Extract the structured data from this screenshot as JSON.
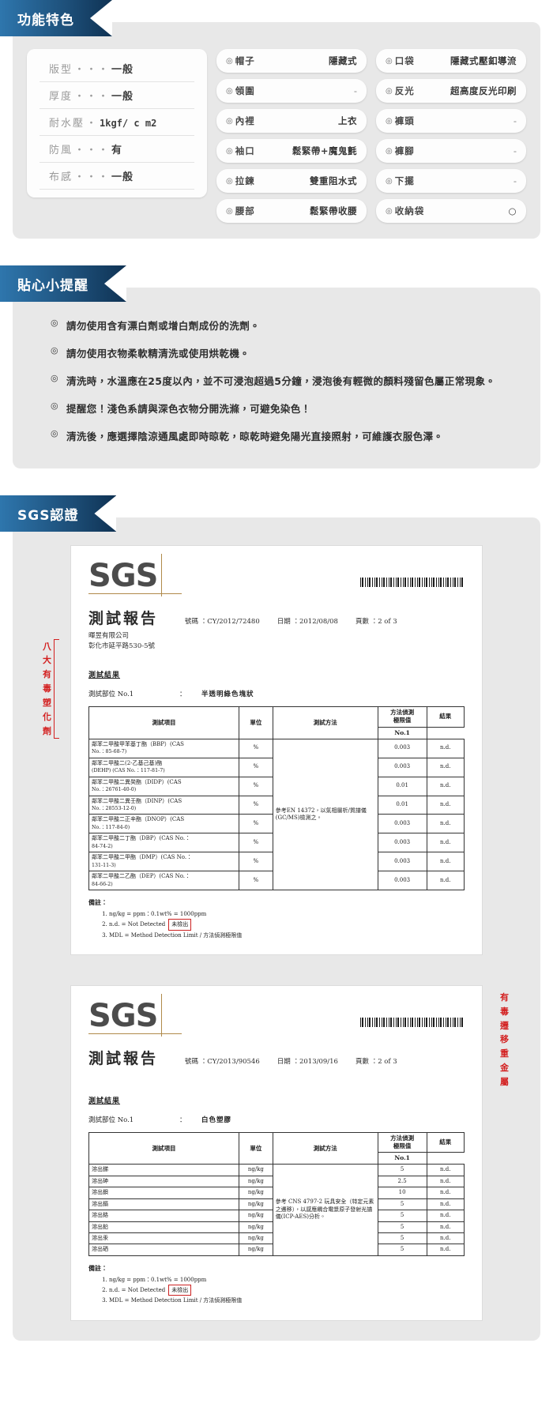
{
  "sections": {
    "features": {
      "title": "功能特色"
    },
    "tips": {
      "title": "貼心小提醒"
    },
    "sgs": {
      "title": "SGS認證"
    }
  },
  "spec_list": [
    {
      "label": "版型",
      "dots": "・・・",
      "value": "一般"
    },
    {
      "label": "厚度",
      "dots": "・・・",
      "value": "一般"
    },
    {
      "label": "耐水壓",
      "dots": "・",
      "value": "1kgf/ c m",
      "sup": "2"
    },
    {
      "label": "防風",
      "dots": "・・・",
      "value": "有"
    },
    {
      "label": "布感",
      "dots": "・・・",
      "value": "一般"
    }
  ],
  "feature_columns": [
    [
      {
        "ring": "◎",
        "name": "帽子",
        "value": "隱藏式"
      },
      {
        "ring": "◎",
        "name": "領圍",
        "value": "-"
      },
      {
        "ring": "◎",
        "name": "內裡",
        "value": "上衣"
      },
      {
        "ring": "◎",
        "name": "袖口",
        "value": "鬆緊帶+魔鬼氈"
      },
      {
        "ring": "◎",
        "name": "拉鍊",
        "value": "雙重阻水式"
      },
      {
        "ring": "◎",
        "name": "腰部",
        "value": "鬆緊帶收腰"
      }
    ],
    [
      {
        "ring": "◎",
        "name": "口袋",
        "value": "隱藏式壓釦導流"
      },
      {
        "ring": "◎",
        "name": "反光",
        "value": "超高度反光印刷"
      },
      {
        "ring": "◎",
        "name": "褲頭",
        "value": "-"
      },
      {
        "ring": "◎",
        "name": "褲腳",
        "value": "-"
      },
      {
        "ring": "◎",
        "name": "下擺",
        "value": "-"
      },
      {
        "ring": "◎",
        "name": "收納袋",
        "value": "○"
      }
    ]
  ],
  "tips": [
    {
      "bullet": "◎",
      "text": "請勿使用含有漂白劑或增白劑成份的洗劑。"
    },
    {
      "bullet": "◎",
      "text": "請勿使用衣物柔軟精清洗或使用烘乾機。"
    },
    {
      "bullet": "◎",
      "text": "清洗時，水溫應在25度以內，並不可浸泡超過5分鐘，浸泡後有輕微的顏料殘留色屬正常現象。"
    },
    {
      "bullet": "◎",
      "text": "提醒您！淺色系請與深色衣物分開洗滌，可避免染色！"
    },
    {
      "bullet": "◎",
      "text": "清洗後，應選擇陰涼通風處即時晾乾，晾乾時避免陽光直接照射，可維護衣服色澤。"
    }
  ],
  "certificates": [
    {
      "logo": "SGS",
      "title": "測試報告",
      "meta": [
        {
          "label": "號碼",
          "value": "CY/2012/72480"
        },
        {
          "label": "日期",
          "value": "2012/08/08"
        },
        {
          "label": "頁數",
          "value": "2 of 3"
        }
      ],
      "company": "暉昱有限公司",
      "address": "彰化市延平路530-5號",
      "results_title": "測試結果",
      "sample_label": "測試部位 No.1",
      "sample_value": "半透明綠色塊狀",
      "annotation_left": [
        "八",
        "大",
        "有",
        "毒",
        "塑",
        "化",
        "劑"
      ],
      "annotation_right": [],
      "columns": [
        "測試項目",
        "單位",
        "測試方法",
        "方法偵測\n極限值",
        "結果\nNo.1"
      ],
      "column_head": {
        "item": "測試項目",
        "unit": "單位",
        "method": "測試方法",
        "limit_l1": "方法偵測",
        "limit_l2": "極限值",
        "result_l1": "結果",
        "result_l2": "No.1"
      },
      "method_text": "參考EN 14372，以氣相層析/質譜儀(GC/MS)檢測之。",
      "rows": [
        {
          "item": "鄰苯二甲酸甲苯基丁酯（BBP）(CAS",
          "cas": "No.：85-68-7)",
          "unit": "%",
          "limit": "0.003",
          "result": "n.d."
        },
        {
          "item": "鄰苯二甲酸二(2-乙基己基)酯",
          "cas": "(DEHP) (CAS No.：117-81-7)",
          "unit": "%",
          "limit": "0.003",
          "result": "n.d."
        },
        {
          "item": "鄰苯二甲酸二異癸酯（DIDP）(CAS",
          "cas": "No.：26761-40-0)",
          "unit": "%",
          "limit": "0.01",
          "result": "n.d."
        },
        {
          "item": "鄰苯二甲酸二異壬酯（DINP）(CAS",
          "cas": "No.：28553-12-0)",
          "unit": "%",
          "limit": "0.01",
          "result": "n.d."
        },
        {
          "item": "鄰苯二甲酸二正辛酯（DNOP）(CAS",
          "cas": "No.：117-84-0)",
          "unit": "%",
          "limit": "0.003",
          "result": "n.d."
        },
        {
          "item": "鄰苯二甲酸二丁酯（DBP）(CAS No.：",
          "cas": "84-74-2)",
          "unit": "%",
          "limit": "0.003",
          "result": "n.d."
        },
        {
          "item": "鄰苯二甲酸二甲酯（DMP）(CAS No.：",
          "cas": "131-11-3)",
          "unit": "%",
          "limit": "0.003",
          "result": "n.d."
        },
        {
          "item": "鄰苯二甲酸二乙酯（DEP）(CAS No.：",
          "cas": "84-66-2)",
          "unit": "%",
          "limit": "0.003",
          "result": "n.d."
        }
      ],
      "remarks_title": "備註：",
      "remarks": [
        "ng/kg = ppm：0.1wt% = 1000ppm",
        "n.d. = Not Detected",
        "MDL = Method Detection Limit / 方法偵測極限值"
      ],
      "nd_box": "未檢出"
    },
    {
      "logo": "SGS",
      "title": "測試報告",
      "meta": [
        {
          "label": "號碼",
          "value": "CY/2013/90546"
        },
        {
          "label": "日期",
          "value": "2013/09/16"
        },
        {
          "label": "頁數",
          "value": "2 of 3"
        }
      ],
      "company": "",
      "address": "",
      "results_title": "測試結果",
      "sample_label": "測試部位 No.1",
      "sample_value": "白色塑膠",
      "annotation_left": [],
      "annotation_right": [
        "有",
        "毒",
        "遷",
        "移",
        "重",
        "金",
        "屬"
      ],
      "column_head": {
        "item": "測試項目",
        "unit": "單位",
        "method": "測試方法",
        "limit_l1": "方法偵測",
        "limit_l2": "極限值",
        "result_l1": "結果",
        "result_l2": "No.1"
      },
      "method_text": "參考 CNS 4797-2 玩具安全（特定元素之遷移），以感應耦合電漿原子發射光譜儀(ICP-AES)分析。",
      "rows": [
        {
          "item": "溶出銻",
          "cas": "",
          "unit": "ng/kg",
          "limit": "5",
          "result": "n.d."
        },
        {
          "item": "溶出砷",
          "cas": "",
          "unit": "ng/kg",
          "limit": "2.5",
          "result": "n.d."
        },
        {
          "item": "溶出鋇",
          "cas": "",
          "unit": "ng/kg",
          "limit": "10",
          "result": "n.d."
        },
        {
          "item": "溶出鎘",
          "cas": "",
          "unit": "ng/kg",
          "limit": "5",
          "result": "n.d."
        },
        {
          "item": "溶出鉻",
          "cas": "",
          "unit": "ng/kg",
          "limit": "5",
          "result": "n.d."
        },
        {
          "item": "溶出鉛",
          "cas": "",
          "unit": "ng/kg",
          "limit": "5",
          "result": "n.d."
        },
        {
          "item": "溶出汞",
          "cas": "",
          "unit": "ng/kg",
          "limit": "5",
          "result": "n.d."
        },
        {
          "item": "溶出硒",
          "cas": "",
          "unit": "ng/kg",
          "limit": "5",
          "result": "n.d."
        }
      ],
      "remarks_title": "備註：",
      "remarks": [
        "ng/kg = ppm：0.1wt% = 1000ppm",
        "n.d. = Not Detected",
        "MDL = Method Detection Limit / 方法偵測極限值"
      ],
      "nd_box": "未檢出"
    }
  ],
  "colors": {
    "ribbon_dark": "#11375a",
    "ribbon_light": "#2e76ad",
    "panel_bg": "#e8e8e8",
    "annotation_red": "#d32020",
    "sgs_gold": "#b08a4a"
  }
}
